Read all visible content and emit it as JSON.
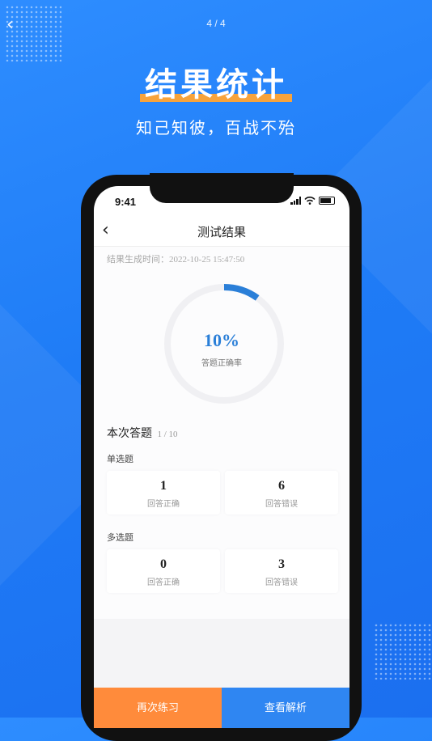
{
  "pager": "4 / 4",
  "hero": {
    "title": "结果统计",
    "subtitle": "知己知彼，百战不殆"
  },
  "status": {
    "time": "9:41"
  },
  "nav": {
    "title": "测试结果"
  },
  "result": {
    "gen_label": "结果生成时间：",
    "gen_time": "2022-10-25 15:47:50",
    "percent_text": "10%",
    "percent_value": 10,
    "percent_label": "答题正确率"
  },
  "section": {
    "title": "本次答题",
    "count": "1 / 10",
    "single": {
      "label": "单选题",
      "correct": "1",
      "correct_label": "回答正确",
      "wrong": "6",
      "wrong_label": "回答错误"
    },
    "multi": {
      "label": "多选题",
      "correct": "0",
      "correct_label": "回答正确",
      "wrong": "3",
      "wrong_label": "回答错误"
    }
  },
  "buttons": {
    "retry": "再次练习",
    "review": "查看解析"
  },
  "colors": {
    "accent": "#2a7fd8",
    "orange": "#ff8b3b",
    "blue_button": "#2f86f2",
    "background": "#1f7cf6"
  }
}
